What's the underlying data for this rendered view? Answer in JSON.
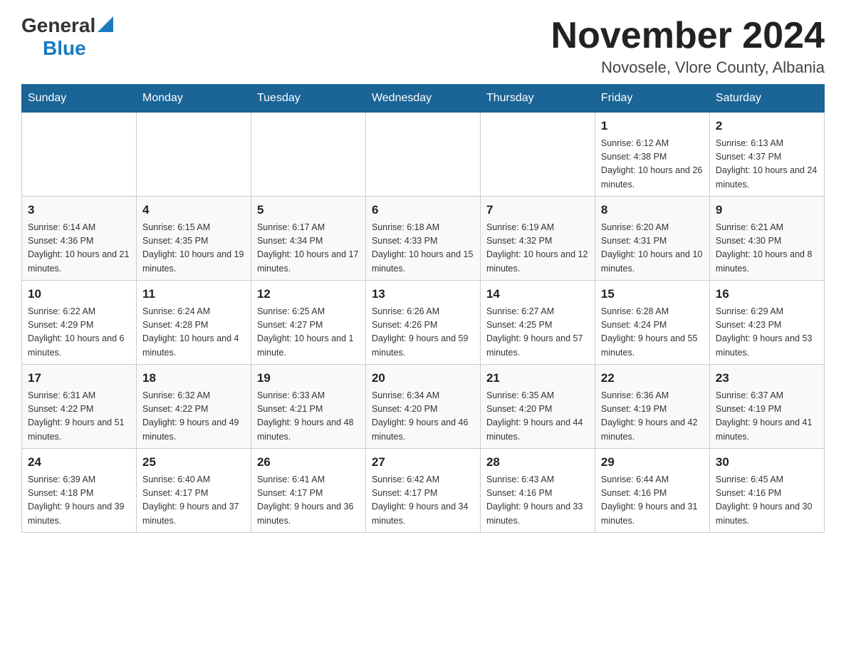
{
  "header": {
    "logo_general": "General",
    "logo_blue": "Blue",
    "month_title": "November 2024",
    "location": "Novosele, Vlore County, Albania"
  },
  "weekdays": [
    "Sunday",
    "Monday",
    "Tuesday",
    "Wednesday",
    "Thursday",
    "Friday",
    "Saturday"
  ],
  "weeks": [
    [
      {
        "day": "",
        "sunrise": "",
        "sunset": "",
        "daylight": ""
      },
      {
        "day": "",
        "sunrise": "",
        "sunset": "",
        "daylight": ""
      },
      {
        "day": "",
        "sunrise": "",
        "sunset": "",
        "daylight": ""
      },
      {
        "day": "",
        "sunrise": "",
        "sunset": "",
        "daylight": ""
      },
      {
        "day": "",
        "sunrise": "",
        "sunset": "",
        "daylight": ""
      },
      {
        "day": "1",
        "sunrise": "Sunrise: 6:12 AM",
        "sunset": "Sunset: 4:38 PM",
        "daylight": "Daylight: 10 hours and 26 minutes."
      },
      {
        "day": "2",
        "sunrise": "Sunrise: 6:13 AM",
        "sunset": "Sunset: 4:37 PM",
        "daylight": "Daylight: 10 hours and 24 minutes."
      }
    ],
    [
      {
        "day": "3",
        "sunrise": "Sunrise: 6:14 AM",
        "sunset": "Sunset: 4:36 PM",
        "daylight": "Daylight: 10 hours and 21 minutes."
      },
      {
        "day": "4",
        "sunrise": "Sunrise: 6:15 AM",
        "sunset": "Sunset: 4:35 PM",
        "daylight": "Daylight: 10 hours and 19 minutes."
      },
      {
        "day": "5",
        "sunrise": "Sunrise: 6:17 AM",
        "sunset": "Sunset: 4:34 PM",
        "daylight": "Daylight: 10 hours and 17 minutes."
      },
      {
        "day": "6",
        "sunrise": "Sunrise: 6:18 AM",
        "sunset": "Sunset: 4:33 PM",
        "daylight": "Daylight: 10 hours and 15 minutes."
      },
      {
        "day": "7",
        "sunrise": "Sunrise: 6:19 AM",
        "sunset": "Sunset: 4:32 PM",
        "daylight": "Daylight: 10 hours and 12 minutes."
      },
      {
        "day": "8",
        "sunrise": "Sunrise: 6:20 AM",
        "sunset": "Sunset: 4:31 PM",
        "daylight": "Daylight: 10 hours and 10 minutes."
      },
      {
        "day": "9",
        "sunrise": "Sunrise: 6:21 AM",
        "sunset": "Sunset: 4:30 PM",
        "daylight": "Daylight: 10 hours and 8 minutes."
      }
    ],
    [
      {
        "day": "10",
        "sunrise": "Sunrise: 6:22 AM",
        "sunset": "Sunset: 4:29 PM",
        "daylight": "Daylight: 10 hours and 6 minutes."
      },
      {
        "day": "11",
        "sunrise": "Sunrise: 6:24 AM",
        "sunset": "Sunset: 4:28 PM",
        "daylight": "Daylight: 10 hours and 4 minutes."
      },
      {
        "day": "12",
        "sunrise": "Sunrise: 6:25 AM",
        "sunset": "Sunset: 4:27 PM",
        "daylight": "Daylight: 10 hours and 1 minute."
      },
      {
        "day": "13",
        "sunrise": "Sunrise: 6:26 AM",
        "sunset": "Sunset: 4:26 PM",
        "daylight": "Daylight: 9 hours and 59 minutes."
      },
      {
        "day": "14",
        "sunrise": "Sunrise: 6:27 AM",
        "sunset": "Sunset: 4:25 PM",
        "daylight": "Daylight: 9 hours and 57 minutes."
      },
      {
        "day": "15",
        "sunrise": "Sunrise: 6:28 AM",
        "sunset": "Sunset: 4:24 PM",
        "daylight": "Daylight: 9 hours and 55 minutes."
      },
      {
        "day": "16",
        "sunrise": "Sunrise: 6:29 AM",
        "sunset": "Sunset: 4:23 PM",
        "daylight": "Daylight: 9 hours and 53 minutes."
      }
    ],
    [
      {
        "day": "17",
        "sunrise": "Sunrise: 6:31 AM",
        "sunset": "Sunset: 4:22 PM",
        "daylight": "Daylight: 9 hours and 51 minutes."
      },
      {
        "day": "18",
        "sunrise": "Sunrise: 6:32 AM",
        "sunset": "Sunset: 4:22 PM",
        "daylight": "Daylight: 9 hours and 49 minutes."
      },
      {
        "day": "19",
        "sunrise": "Sunrise: 6:33 AM",
        "sunset": "Sunset: 4:21 PM",
        "daylight": "Daylight: 9 hours and 48 minutes."
      },
      {
        "day": "20",
        "sunrise": "Sunrise: 6:34 AM",
        "sunset": "Sunset: 4:20 PM",
        "daylight": "Daylight: 9 hours and 46 minutes."
      },
      {
        "day": "21",
        "sunrise": "Sunrise: 6:35 AM",
        "sunset": "Sunset: 4:20 PM",
        "daylight": "Daylight: 9 hours and 44 minutes."
      },
      {
        "day": "22",
        "sunrise": "Sunrise: 6:36 AM",
        "sunset": "Sunset: 4:19 PM",
        "daylight": "Daylight: 9 hours and 42 minutes."
      },
      {
        "day": "23",
        "sunrise": "Sunrise: 6:37 AM",
        "sunset": "Sunset: 4:19 PM",
        "daylight": "Daylight: 9 hours and 41 minutes."
      }
    ],
    [
      {
        "day": "24",
        "sunrise": "Sunrise: 6:39 AM",
        "sunset": "Sunset: 4:18 PM",
        "daylight": "Daylight: 9 hours and 39 minutes."
      },
      {
        "day": "25",
        "sunrise": "Sunrise: 6:40 AM",
        "sunset": "Sunset: 4:17 PM",
        "daylight": "Daylight: 9 hours and 37 minutes."
      },
      {
        "day": "26",
        "sunrise": "Sunrise: 6:41 AM",
        "sunset": "Sunset: 4:17 PM",
        "daylight": "Daylight: 9 hours and 36 minutes."
      },
      {
        "day": "27",
        "sunrise": "Sunrise: 6:42 AM",
        "sunset": "Sunset: 4:17 PM",
        "daylight": "Daylight: 9 hours and 34 minutes."
      },
      {
        "day": "28",
        "sunrise": "Sunrise: 6:43 AM",
        "sunset": "Sunset: 4:16 PM",
        "daylight": "Daylight: 9 hours and 33 minutes."
      },
      {
        "day": "29",
        "sunrise": "Sunrise: 6:44 AM",
        "sunset": "Sunset: 4:16 PM",
        "daylight": "Daylight: 9 hours and 31 minutes."
      },
      {
        "day": "30",
        "sunrise": "Sunrise: 6:45 AM",
        "sunset": "Sunset: 4:16 PM",
        "daylight": "Daylight: 9 hours and 30 minutes."
      }
    ]
  ]
}
